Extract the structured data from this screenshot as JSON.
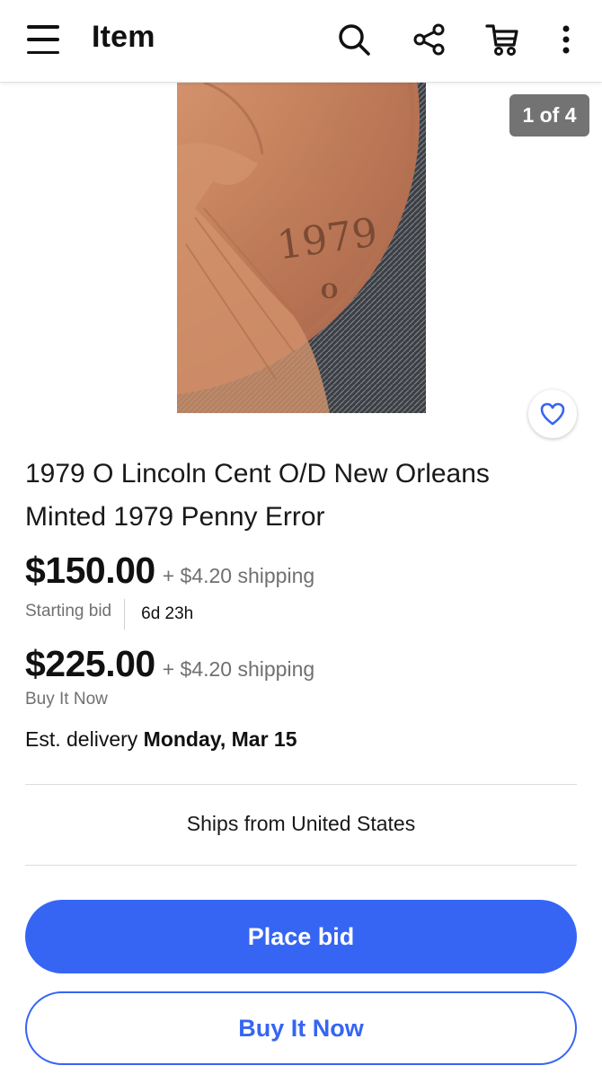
{
  "header": {
    "title": "Item",
    "icons": [
      "menu-icon",
      "search-icon",
      "share-icon",
      "cart-icon",
      "more-icon"
    ]
  },
  "gallery": {
    "counter": "1 of 4",
    "coin_year": "1979",
    "coin_mintmark": "O"
  },
  "item": {
    "title": "1979 O Lincoln Cent O/D New Orleans Minted 1979 Penny Error",
    "bid_price": "$150.00",
    "bid_shipping": "+ $4.20 shipping",
    "bid_label": "Starting bid",
    "time_left": "6d 23h",
    "bin_price": "$225.00",
    "bin_shipping": "+ $4.20 shipping",
    "bin_label": "Buy It Now",
    "delivery_prefix": "Est. delivery",
    "delivery_date": "Monday, Mar 15",
    "ships_from": "Ships from United States"
  },
  "actions": {
    "place_bid": "Place bid",
    "buy_it_now": "Buy It Now"
  },
  "colors": {
    "accent": "#3665f3",
    "text": "#191919",
    "muted": "#707070"
  }
}
